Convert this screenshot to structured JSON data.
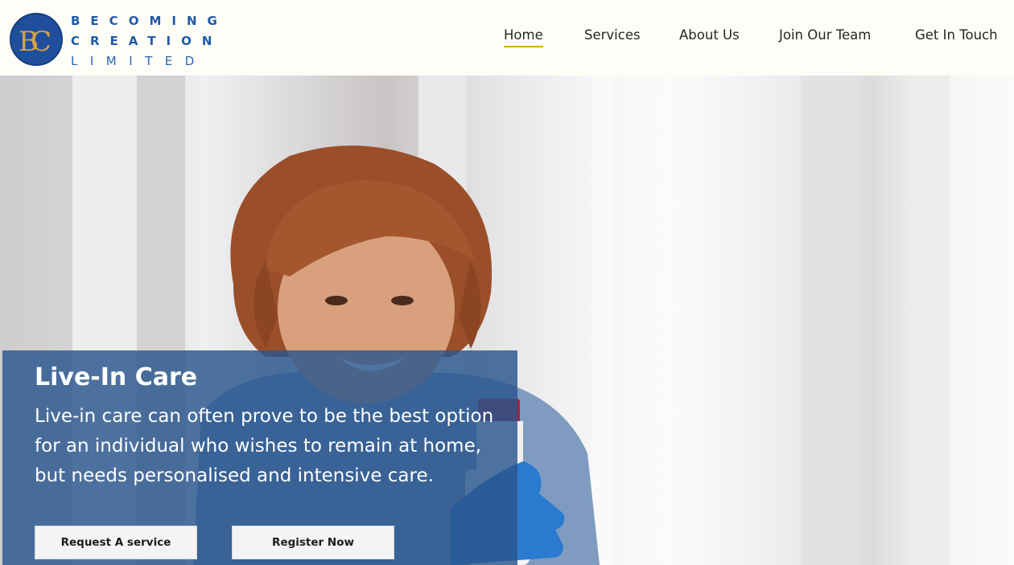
{
  "brand": {
    "monogram": "BC",
    "name_lines": [
      "BECOMING",
      "CREATION",
      "LIMITED"
    ],
    "badge_color": "#1f4f9c",
    "monogram_color": "#d4a24a"
  },
  "nav": {
    "items": [
      {
        "label": "Home",
        "active": true
      },
      {
        "label": "Services",
        "active": false
      },
      {
        "label": "About Us",
        "active": false
      },
      {
        "label": "Join Our Team",
        "active": false
      },
      {
        "label": "Get In Touch",
        "active": false
      }
    ],
    "active_underline_color": "#d9a600"
  },
  "hero": {
    "title": "Live-In Care",
    "description": "Live-in care can often prove to be the best option for an individual who wishes to remain at home, but needs personalised and intensive care.",
    "buttons": {
      "request_label": "Request A service",
      "register_label": "Register Now"
    },
    "overlay_color": "#2a558c"
  }
}
